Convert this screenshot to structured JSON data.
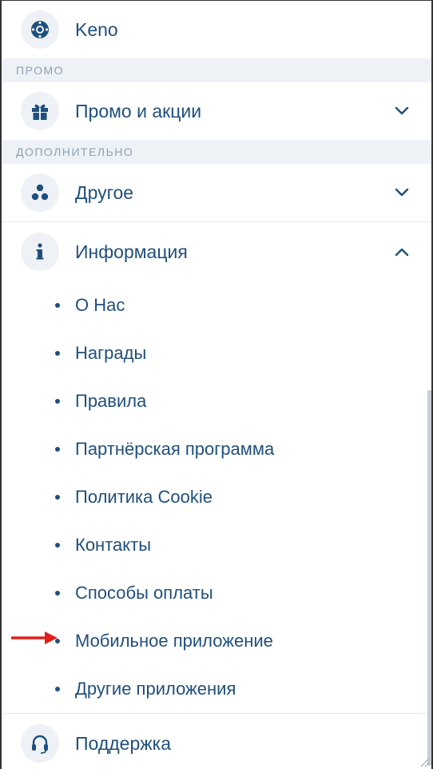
{
  "menu": {
    "keno": {
      "label": "Keno",
      "icon": "keno-icon"
    },
    "promo_section": "ПРОМО",
    "promo": {
      "label": "Промо и акции",
      "icon": "gift-icon",
      "expanded": false
    },
    "extra_section": "ДОПОЛНИТЕЛЬНО",
    "other": {
      "label": "Другое",
      "icon": "dots-icon",
      "expanded": false
    },
    "info": {
      "label": "Информация",
      "icon": "info-icon",
      "expanded": true,
      "items": [
        "О Нас",
        "Награды",
        "Правила",
        "Партнёрская программа",
        "Политика Cookie",
        "Контакты",
        "Способы оплаты",
        "Мобильное приложение",
        "Другие приложения"
      ]
    },
    "support": {
      "label": "Поддержка",
      "icon": "headset-icon"
    }
  },
  "annotation": {
    "arrow_target": "Мобильное приложение",
    "arrow_color": "#e0201b"
  },
  "colors": {
    "text": "#1f4f7c",
    "icon_bg": "#eef2f6",
    "section_bg": "#eef2f6",
    "section_text": "#8da1b5"
  }
}
